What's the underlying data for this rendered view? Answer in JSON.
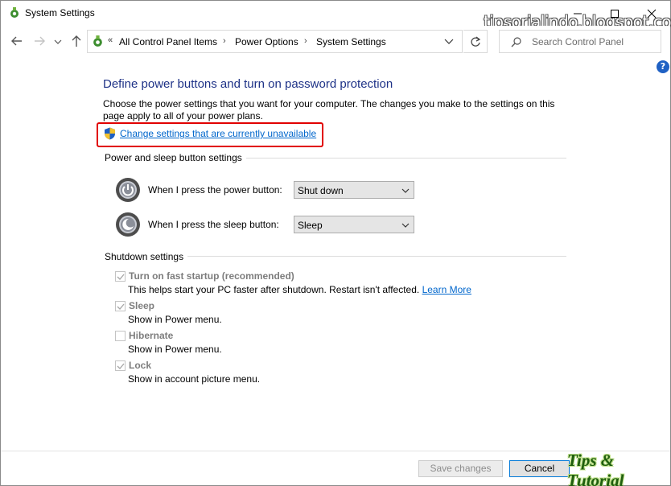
{
  "window": {
    "title": "System Settings",
    "watermark_top": "tipsorialindo.blogspot.com",
    "watermark_bottom": "Tips & Tutorial"
  },
  "nav": {
    "back_icon": "arrow-left-icon",
    "forward_icon": "arrow-right-icon",
    "up_icon": "arrow-up-icon",
    "address_chevron": "«",
    "breadcrumbs": [
      "All Control Panel Items",
      "Power Options",
      "System Settings"
    ],
    "separator": "›",
    "search_placeholder": "Search Control Panel"
  },
  "help": {
    "label": "?"
  },
  "content": {
    "heading": "Define power buttons and turn on password protection",
    "intro": "Choose the power settings that you want for your computer. The changes you make to the settings on this page apply to all of your power plans.",
    "change_link": "Change settings that are currently unavailable",
    "power_sleep_group": "Power and sleep button settings",
    "power_row": {
      "label": "When I press the power button:",
      "value": "Shut down"
    },
    "sleep_row": {
      "label": "When I press the sleep button:",
      "value": "Sleep"
    },
    "shutdown_group": "Shutdown settings",
    "options": [
      {
        "label": "Turn on fast startup (recommended)",
        "checked": true,
        "desc": "This helps start your PC faster after shutdown. Restart isn't affected.",
        "link": "Learn More"
      },
      {
        "label": "Sleep",
        "checked": true,
        "desc": "Show in Power menu."
      },
      {
        "label": "Hibernate",
        "checked": false,
        "desc": "Show in Power menu."
      },
      {
        "label": "Lock",
        "checked": true,
        "desc": "Show in account picture menu."
      }
    ]
  },
  "footer": {
    "save_label": "Save changes",
    "cancel_label": "Cancel"
  },
  "colors": {
    "heading": "#1e3287",
    "link": "#0066cc",
    "highlight": "#e10000",
    "disabled_text": "#7d7d7d"
  }
}
